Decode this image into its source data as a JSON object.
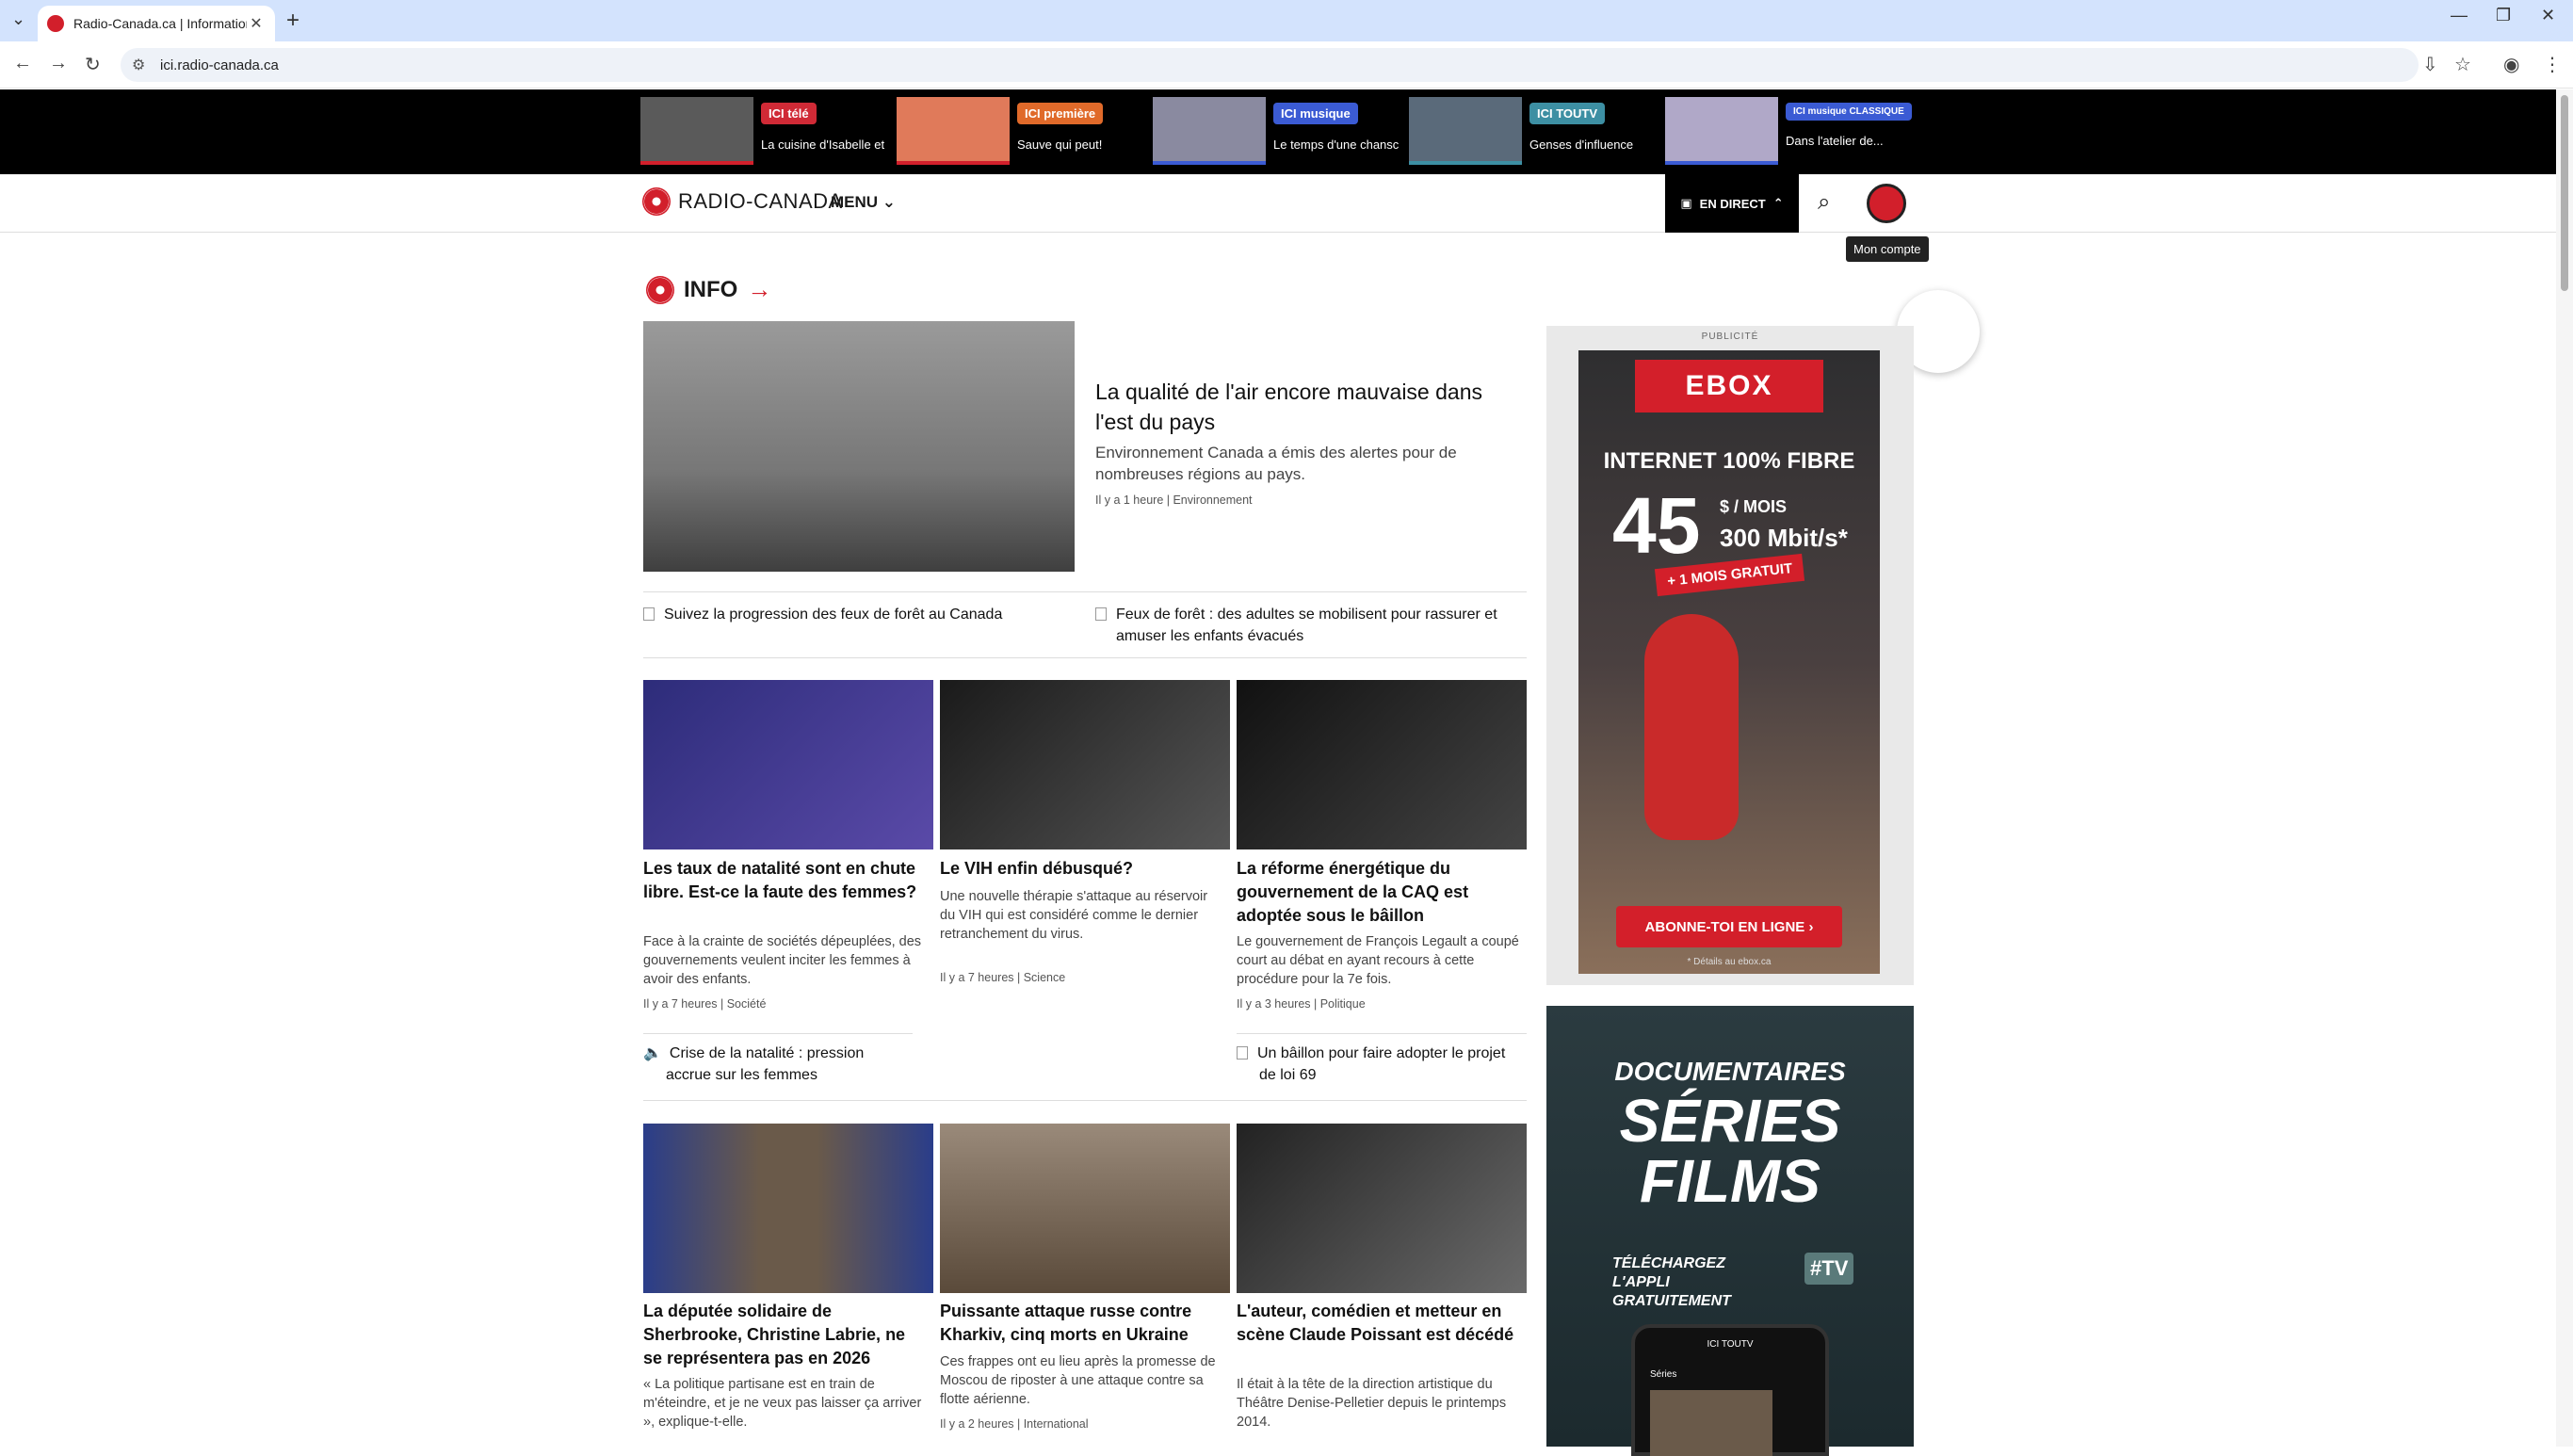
{
  "browser": {
    "tab_title": "Radio-Canada.ca | Information,",
    "url": "ici.radio-canada.ca"
  },
  "promos": [
    {
      "badge": "ICI télé",
      "badge_color": "#d02a36",
      "title": "La cuisine d'Isabelle et"
    },
    {
      "badge": "ICI première",
      "badge_color": "#e06a2a",
      "title": "Sauve qui peut!"
    },
    {
      "badge": "ICI musique",
      "badge_color": "#3b5bd4",
      "title": "Le temps d'une chansc"
    },
    {
      "badge": "ICI TOUTV",
      "badge_color": "#3d8fa3",
      "title": "Genses d'influence"
    },
    {
      "badge": "ICI musique CLASSIQUE",
      "badge_color": "#3b5bd4",
      "title": "Dans l'atelier de..."
    }
  ],
  "site": {
    "logo": "RADIO-CANADA",
    "menu": "MENU",
    "live": "EN DIRECT",
    "tooltip": "Mon compte",
    "section": "INFO"
  },
  "hero": {
    "title": "La qualité de l'air encore mauvaise dans l'est du pays",
    "desc": "Environnement Canada a émis des alertes pour de nombreuses régions au pays.",
    "meta": "Il y a 1 heure | Environnement"
  },
  "related": [
    "Suivez la progression des feux de forêt au Canada",
    "Feux de forêt : des adultes se mobilisent pour rassurer et amuser les enfants évacués"
  ],
  "cards_row1": [
    {
      "title": "Les taux de natalité sont en chute libre. Est-ce la faute des femmes?",
      "desc": "Face à la crainte de sociétés dépeuplées, des gouvernements veulent inciter les femmes à avoir des enfants.",
      "meta": "Il y a 7 heures | Société",
      "img_color": "#3b3a8a"
    },
    {
      "title": "Le VIH enfin débusqué?",
      "desc": "Une nouvelle thérapie s'attaque au réservoir du VIH qui est considéré comme le dernier retranchement du virus.",
      "meta": "Il y a 7 heures | Science",
      "img_color": "#2a2a2a"
    },
    {
      "title": "La réforme énergétique du gouvernement de la CAQ est adoptée sous le bâillon",
      "desc": "Le gouvernement de François Legault a coupé court au débat en ayant recours à cette procédure pour la 7e fois.",
      "meta": "Il y a 3 heures | Politique",
      "img_color": "#1e1e1e"
    }
  ],
  "related_row1": [
    "Crise de la natalité : pression accrue sur les femmes",
    "Un bâillon pour faire adopter le projet de loi 69"
  ],
  "cards_row2": [
    {
      "title": "La députée solidaire de Sherbrooke, Christine Labrie, ne se représentera pas en 2026",
      "desc": "« La politique partisane est en train de m'éteindre, et je ne veux pas laisser ça arriver », explique-t-elle.",
      "img_color": "#3a4f8a"
    },
    {
      "title": "Puissante attaque russe contre Kharkiv, cinq morts en Ukraine",
      "desc": "Ces frappes ont eu lieu après la promesse de Moscou de riposter à une attaque contre sa flotte aérienne.",
      "meta": "Il y a 2 heures | International",
      "img_color": "#7a6a5a"
    },
    {
      "title": "L'auteur, comédien et metteur en scène Claude Poissant est décédé",
      "desc": "Il était à la tête de la direction artistique du Théâtre Denise-Pelletier depuis le printemps 2014.",
      "img_color": "#3a3a3a"
    }
  ],
  "ad1": {
    "label": "PUBLICITÉ",
    "brand": "EBOX",
    "line1": "INTERNET 100% FIBRE",
    "price": "45",
    "per_month": "$ / MOIS",
    "speed": "300 Mbit/s*",
    "promo": "+ 1 MOIS GRATUIT",
    "cta": "ABONNE-TOI EN LIGNE ›",
    "fine": "* Détails au ebox.ca"
  },
  "ad2": {
    "line1": "DOCUMENTAIRES",
    "line2": "SÉRIES",
    "line3": "FILMS",
    "cta": "TÉLÉCHARGEZ L'APPLI GRATUITEMENT",
    "tag": "TV",
    "phone_top": "ICI TOUTV",
    "phone_label": "Séries"
  }
}
